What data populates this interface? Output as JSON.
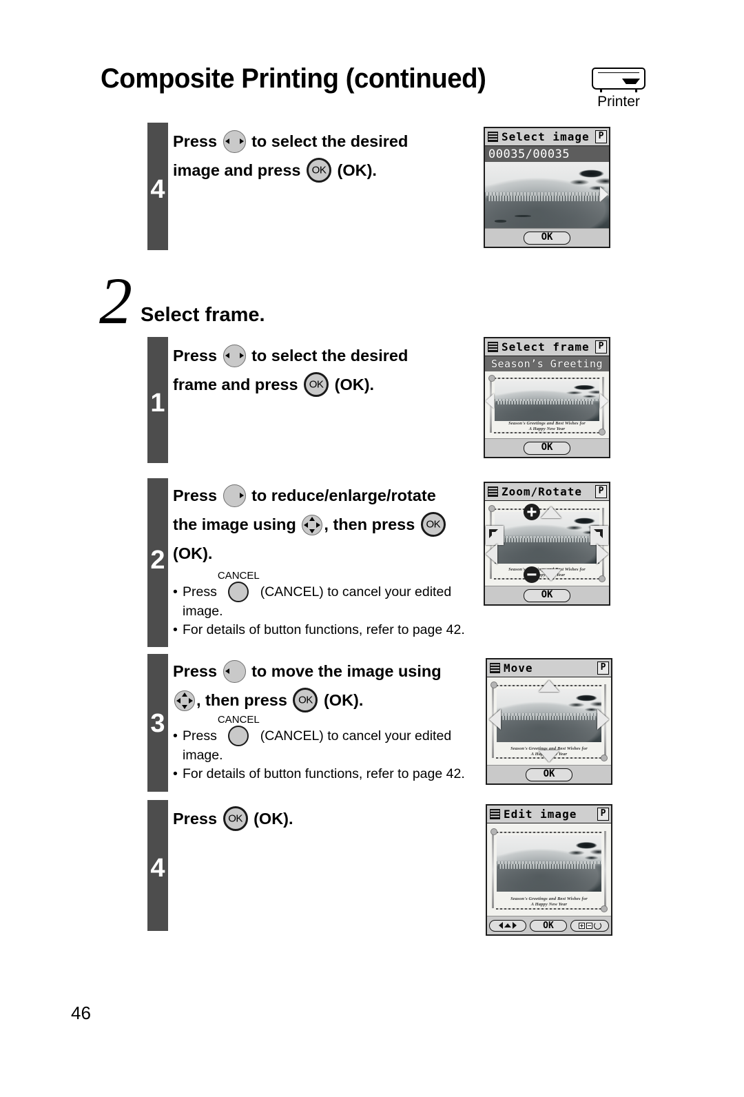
{
  "header": {
    "title": "Composite Printing (continued)",
    "device_label": "Printer",
    "device_icon": "printer-icon"
  },
  "page_number": "46",
  "continued_step": {
    "number": "4",
    "lines": [
      {
        "parts": [
          "Press ",
          "four-way-left-right-button",
          " to select the desired"
        ]
      },
      {
        "parts": [
          "image and press ",
          "ok-button",
          " (OK)."
        ]
      }
    ],
    "line1_pre": "Press",
    "line1_post": "to select the desired",
    "line2_pre": "image and press",
    "line2_post": "(OK).",
    "screen": {
      "title": "Select image",
      "mode_badge": "P",
      "counter": "00035/00035",
      "ok_label": "OK"
    }
  },
  "section": {
    "number": "2",
    "title": "Select frame.",
    "steps": [
      {
        "number": "1",
        "line1_pre": "Press",
        "line1_post": "to select the desired",
        "line2_pre": "frame and press",
        "line2_post": "(OK).",
        "notes": [],
        "screen": {
          "title": "Select frame",
          "mode_badge": "P",
          "band_title": "Season’s Greeting",
          "greeting_line1": "Season's Greetings and Best Wishes for",
          "greeting_line2": "A Happy New Year",
          "ok_label": "OK"
        }
      },
      {
        "number": "2",
        "line1_pre": "Press",
        "line1_post": "to reduce/enlarge/rotate",
        "line2_pre": "the image using",
        "line2_mid": ", then press",
        "line3": "(OK).",
        "cancel_label": "CANCEL",
        "note1_pre": "Press",
        "note1_post": "(CANCEL) to cancel your edited",
        "note1_cont": "image.",
        "note2": "For details of button functions, refer to page 42.",
        "screen": {
          "title": "Zoom/Rotate",
          "mode_badge": "P",
          "greeting_line1": "Season's Greetings and Best Wishes for",
          "greeting_line2": "A Happy New Year",
          "ok_label": "OK"
        }
      },
      {
        "number": "3",
        "line1_pre": "Press",
        "line1_post": "to move the image using",
        "line2_mid": ", then press",
        "line2_post": "(OK).",
        "cancel_label": "CANCEL",
        "note1_pre": "Press",
        "note1_post": "(CANCEL) to cancel your edited",
        "note1_cont": "image.",
        "note2": "For details of button functions, refer to page 42.",
        "screen": {
          "title": "Move",
          "mode_badge": "P",
          "greeting_line1": "Season's Greetings and Best Wishes for",
          "greeting_line2": "A Happy New Year",
          "ok_label": "OK"
        }
      },
      {
        "number": "4",
        "line1_pre": "Press",
        "line1_post": "(OK).",
        "notes": [],
        "screen": {
          "title": "Edit image",
          "mode_badge": "P",
          "greeting_line1": "Season's Greetings and Best Wishes for",
          "greeting_line2": "A Happy New Year",
          "ok_label": "OK"
        }
      }
    ]
  },
  "colors": {
    "step_bar": "#4d4d4d",
    "lcd_border": "#1c1c1c",
    "lcd_band": "#6a6a6a",
    "lcd_counter": "#5d5d5d"
  }
}
